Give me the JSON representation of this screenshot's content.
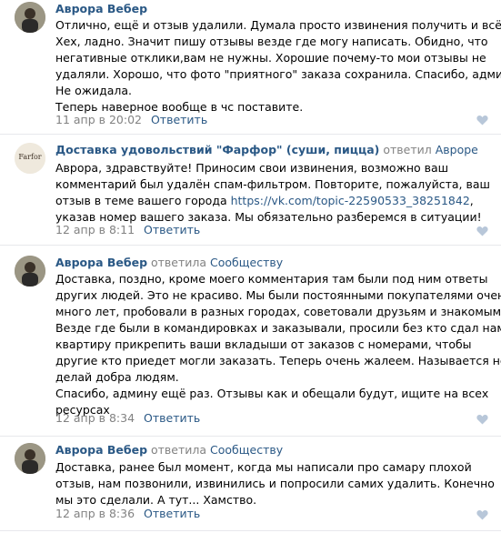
{
  "comments": [
    {
      "author": "Аврора Вебер",
      "reply_word": "",
      "reply_to": "",
      "lines": [
        "Отлично, ещё и отзыв удалили. Думала просто извинения получить и всё.",
        "Хех, ладно. Значит пишу отзывы везде где могу написать. Обидно, что",
        "негативные отклики,вам не нужны. Хорошие почему-то мои отзывы не",
        "удаляли. Хорошо, что фото \"приятного\" заказа сохранила. Спасибо, админ.",
        "Не ожидала.",
        "Теперь наверное вообще в чс поставите."
      ],
      "date": "11 апр в 20:02",
      "reply_label": "Ответить"
    },
    {
      "author": "Доставка удовольствий \"Фарфор\" (суши, пицца)",
      "reply_word": "ответил",
      "reply_to": "Авроре",
      "avatar_text": "Farfor",
      "line1": "Аврора, здравствуйте! Приносим свои извинения, возможно ваш",
      "line2": "комментарий был удалён спам-фильтром. Повторите, пожалуйста, ваш",
      "line3_prefix": "отзыв в теме вашего города ",
      "link": "https://vk.com/topic-22590533_38251842",
      "line3_suffix": ",",
      "line4": "указав номер вашего заказа. Мы обязательно разберемся в ситуации!",
      "date": "12 апр в 8:11",
      "reply_label": "Ответить"
    },
    {
      "author": "Аврора Вебер",
      "reply_word": "ответила",
      "reply_to": "Сообществу",
      "lines": [
        "Доставка, поздно, кроме моего комментария там были под ним ответы",
        "других людей. Это не красиво. Мы были постоянными покупателями очень",
        "много лет, пробовали в разных городах, советовали друзьям и знакомым.",
        "Везде где были в командировках и заказывали, просили без кто сдал нам",
        "квартиру прикрепить ваши вкладыши от заказов с номерами, чтобы",
        "другие кто приедет могли заказать. Теперь очень жалеем. Называется не",
        "делай добра людям.",
        "Спасибо, админу ещё раз. Отзывы как и обещали будут, ищите на всех",
        "ресурсах"
      ],
      "date": "12 апр в 8:34",
      "reply_label": "Ответить"
    },
    {
      "author": "Аврора Вебер",
      "reply_word": "ответила",
      "reply_to": "Сообществу",
      "lines": [
        "Доставка, ранее был момент, когда мы написали про самару плохой",
        "отзыв, нам позвонили, извинились и попросили самих удалить. Конечно",
        "мы это сделали. А тут... Хамство."
      ],
      "date": "12 апр в 8:36",
      "reply_label": "Ответить"
    }
  ],
  "colors": {
    "link": "#2a5885",
    "muted": "#828282",
    "heart": "#b8c7d9"
  },
  "icons": {
    "like": "heart-icon",
    "avatar_photo": "user-photo"
  }
}
